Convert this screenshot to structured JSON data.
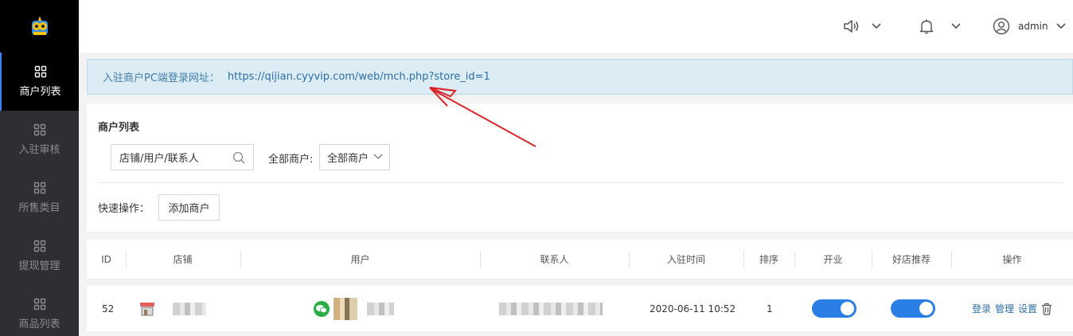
{
  "sidebar": {
    "items": [
      {
        "label": "商户列表",
        "active": true
      },
      {
        "label": "入驻审核",
        "active": false
      },
      {
        "label": "所售类目",
        "active": false
      },
      {
        "label": "提现管理",
        "active": false
      },
      {
        "label": "商品列表",
        "active": false
      }
    ]
  },
  "topbar": {
    "user_name": "admin",
    "icons": [
      "speaker-icon",
      "bell-icon",
      "user-circle-icon"
    ]
  },
  "notice": {
    "label": "入驻商户PC端登录网址：",
    "url": "https://qijian.cyyvip.com/web/mch.php?store_id=1"
  },
  "panel": {
    "title": "商户列表",
    "search_placeholder": "店铺/用户/联系人",
    "filter_label": "全部商户:",
    "filter_value": "全部商户",
    "quick_label": "快速操作：",
    "add_button": "添加商户"
  },
  "table": {
    "headers": [
      "ID",
      "店铺",
      "用户",
      "联系人",
      "入驻时间",
      "排序",
      "开业",
      "好店推荐",
      "操作"
    ],
    "rows": [
      {
        "id": "52",
        "time": "2020-06-11 10:52",
        "sort": "1",
        "open": true,
        "recommend": true,
        "actions": [
          "登录",
          "管理",
          "设置"
        ]
      }
    ]
  },
  "colors": {
    "accent": "#2b7ee4",
    "sidebar_bg": "#2f2f33",
    "notice_bg": "#dcecf5",
    "arrow": "#d9252a"
  }
}
